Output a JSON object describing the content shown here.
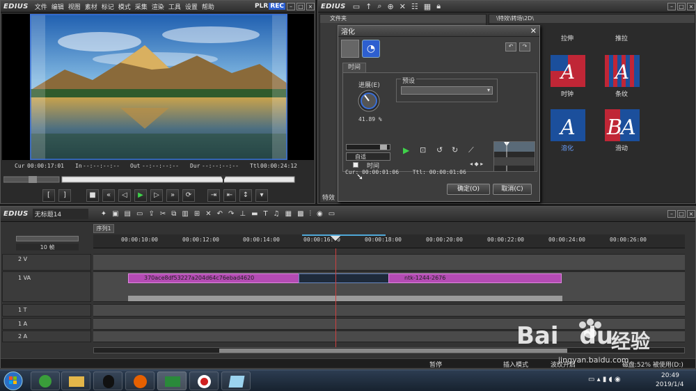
{
  "player": {
    "logo": "EDIUS",
    "menu": [
      "文件",
      "编辑",
      "视图",
      "素材",
      "标记",
      "模式",
      "采集",
      "渲染",
      "工具",
      "设置",
      "帮助"
    ],
    "plr": "PLR",
    "rec": "REC",
    "cur_label": "Cur",
    "cur_value": "00:00:17:01",
    "in_label": "In",
    "in_value": "--:--:--:--",
    "out_label": "Out",
    "out_value": "--:--:--:--",
    "dur_label": "Dur",
    "dur_value": "--:--:--:--",
    "ttl_label": "Ttl",
    "ttl_value": "00:00:24:12"
  },
  "bin": {
    "logo": "EDIUS",
    "folder_header": "文件夹",
    "path": "\\特效\\转场\\2D\\",
    "effects": [
      {
        "label": "拉伸",
        "letter": "A"
      },
      {
        "label": "推拉",
        "letter": "A"
      },
      {
        "label": "时钟",
        "letter": "A"
      },
      {
        "label": "条纹",
        "letter": "A"
      },
      {
        "label": "溶化",
        "letter": "A"
      },
      {
        "label": "滑动",
        "letter": "A"
      }
    ],
    "side_label": "特效"
  },
  "dialog": {
    "title": "溶化",
    "tab": "时间",
    "progress_label": "进展(E)",
    "progress_value": "41.89 %",
    "preset_label": "预设",
    "speed_option": "自适",
    "time_label": "时间",
    "cur_line": "Cur: 00:00:01:06",
    "ttl_line": "Ttl: 00:00:01:06",
    "ok": "确定(O)",
    "cancel": "取消(C)"
  },
  "timeline": {
    "logo": "EDIUS",
    "project_name": "无标题14",
    "sequence_tab": "序列1",
    "zoom": "10 帧",
    "ruler": [
      "00:00:10:00",
      "00:00:12:00",
      "00:00:14:00",
      "00:00:16:00",
      "00:00:18:00",
      "00:00:20:00",
      "00:00:22:00",
      "00:00:24:00",
      "00:00:26:00"
    ],
    "tracks": [
      "2 V",
      "1 VA",
      "1 T",
      "1 A",
      "2 A"
    ],
    "clip1": "370ace8df53227a204d64c76ebad4620",
    "clip2": "ntk-1244-2676",
    "status_pause": "暂停",
    "status_insert": "插入模式",
    "status_ripple": "波纹开启",
    "status_disk": "磁盘:52% 被使用(D:)"
  },
  "taskbar": {
    "time": "20:49",
    "date": "2019/1/4"
  },
  "watermark": {
    "brand": "Bai",
    "brand2": "du",
    "cn": "经验",
    "url": "jingyan.baidu.com"
  }
}
